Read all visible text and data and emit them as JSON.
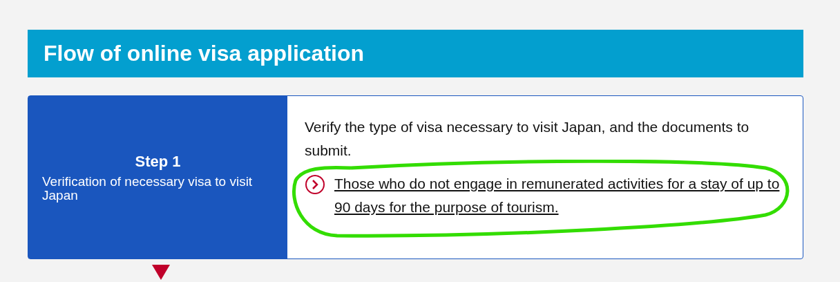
{
  "section": {
    "title": "Flow of online visa application"
  },
  "steps": [
    {
      "number": "Step 1",
      "name": "Verification of necessary visa to visit Japan",
      "description": "Verify the type of visa necessary to visit Japan, and the documents to submit.",
      "links": [
        {
          "text": "Those who do not engage in remunerated activities for a stay of up to 90 days for the purpose of tourism.",
          "highlighted": true
        }
      ]
    }
  ]
}
